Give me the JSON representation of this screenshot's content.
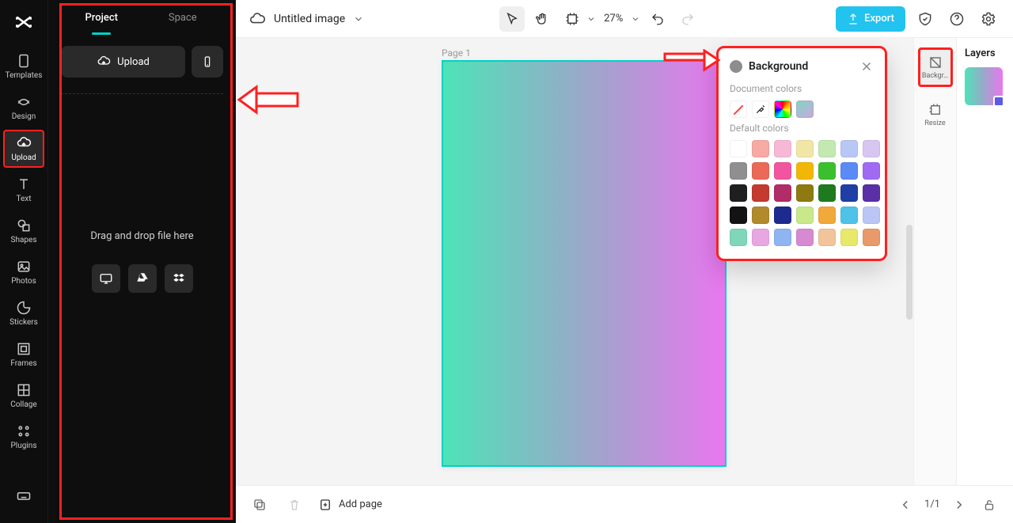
{
  "rail": {
    "items": [
      {
        "label": "Templates"
      },
      {
        "label": "Design"
      },
      {
        "label": "Upload"
      },
      {
        "label": "Text"
      },
      {
        "label": "Shapes"
      },
      {
        "label": "Photos"
      },
      {
        "label": "Stickers"
      },
      {
        "label": "Frames"
      },
      {
        "label": "Collage"
      },
      {
        "label": "Plugins"
      }
    ]
  },
  "sidebar": {
    "tabs": {
      "project": "Project",
      "space": "Space"
    },
    "upload": "Upload",
    "drop": "Drag and drop file here"
  },
  "topbar": {
    "title": "Untitled image",
    "zoom": "27%",
    "export": "Export"
  },
  "canvas": {
    "page_label": "Page 1"
  },
  "bottombar": {
    "addpage": "Add page",
    "pager": "1/1"
  },
  "rightRail": {
    "background": "Backgr…",
    "resize": "Resize"
  },
  "layers": {
    "title": "Layers"
  },
  "popover": {
    "title": "Background",
    "doc": "Document colors",
    "def": "Default colors",
    "defaultColors": [
      "#ffffff",
      "#f7a9a3",
      "#f7b8d6",
      "#f2e6a6",
      "#c2eab0",
      "#b8c7f5",
      "#d8c6f2",
      "#8f8f8f",
      "#eb6a57",
      "#f255a0",
      "#f2b705",
      "#3cbf2e",
      "#5a8af5",
      "#a06af2",
      "#1f1f1f",
      "#c43a2f",
      "#b02d67",
      "#8f7a12",
      "#1f7a1f",
      "#1f3ea6",
      "#5b2fa6",
      "#131313",
      "#b08a2b",
      "#1f2a8f",
      "#c8e88a",
      "#f2a93b",
      "#4fc2e8",
      "#bcc6f5",
      "#7fd6b8",
      "#e8a7e2",
      "#8fb4f2",
      "#d68ad1",
      "#f2c49a",
      "#e8e86a",
      "#e89a6a"
    ]
  }
}
